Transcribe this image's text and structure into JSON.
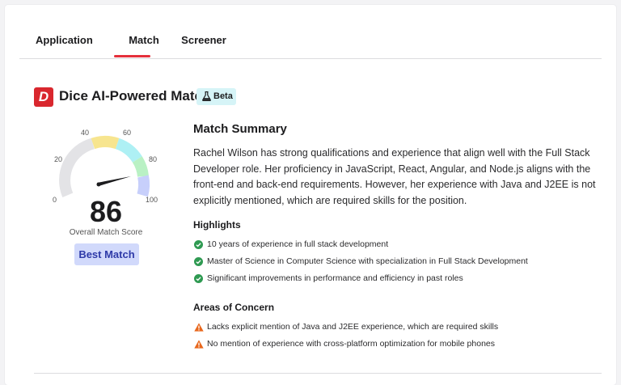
{
  "tabs": [
    {
      "label": "Application",
      "selected": false
    },
    {
      "label": "Match",
      "selected": true
    },
    {
      "label": "Screener",
      "selected": false
    }
  ],
  "header": {
    "logo_icon": "dice-logo-icon",
    "title": "Dice AI-Powered Match",
    "badge": "Beta",
    "badge_icon": "flask-icon"
  },
  "gauge": {
    "ticks": [
      "0",
      "20",
      "40",
      "60",
      "80",
      "100"
    ],
    "score": "86",
    "score_value": 86,
    "label": "Overall Match Score",
    "rating": "Best Match"
  },
  "summary": {
    "title": "Match Summary",
    "text": "Rachel Wilson has strong qualifications and experience that align well with the Full Stack Developer role. Her proficiency in JavaScript, React, Angular, and Node.js aligns with the front-end and back-end requirements. However, her experience with Java and J2EE is not explicitly mentioned, which are required skills for the position."
  },
  "highlights": {
    "title": "Highlights",
    "icon": "check-circle-icon",
    "items": [
      "10 years of experience in full stack development",
      "Master of Science in Computer Science with specialization in Full Stack Development",
      "Significant improvements in performance and efficiency in past roles"
    ]
  },
  "concerns": {
    "title": "Areas of Concern",
    "icon": "warning-triangle-icon",
    "items": [
      "Lacks explicit mention of Java and J2EE experience, which are required skills",
      "No mention of experience with cross-platform optimization for mobile phones"
    ]
  },
  "colors": {
    "accent_red": "#e5303b",
    "gauge_grey": "#e3e3e6",
    "gauge_yellow": "#f7e58f",
    "gauge_cyan": "#aef0f4",
    "gauge_green": "#b9f1c4",
    "gauge_blue": "#c7cffb",
    "check_green": "#2f9a52",
    "warning_orange": "#e8671c"
  }
}
